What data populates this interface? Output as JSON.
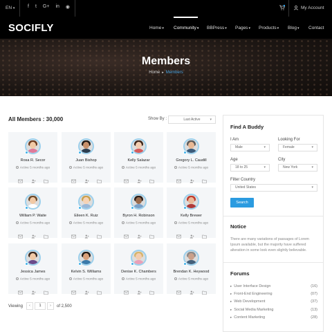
{
  "topbar": {
    "language": "EN",
    "social_icons": [
      "facebook-icon",
      "twitter-icon",
      "google-plus-icon",
      "linkedin-icon",
      "rss-icon"
    ],
    "account_label": "My Account"
  },
  "brand": {
    "logo_part1": "SOCI",
    "logo_part2": "FLY"
  },
  "nav": {
    "items": [
      {
        "label": "Home",
        "caret": "▾"
      },
      {
        "label": "Community",
        "caret": "▾"
      },
      {
        "label": "BBPress",
        "caret": "▾"
      },
      {
        "label": "Pages",
        "caret": "▾"
      },
      {
        "label": "Products",
        "caret": "▾"
      },
      {
        "label": "Blog",
        "caret": "▾"
      },
      {
        "label": "Contact",
        "caret": ""
      }
    ]
  },
  "hero": {
    "title": "Members",
    "breadcrumb_home": "Home",
    "breadcrumb_current": "Members"
  },
  "members_header": {
    "title": "All Members : 30,000",
    "show_by_label": "Show By :",
    "show_by_value": "Last Active"
  },
  "members": [
    {
      "name": "Rosa R. Secor",
      "active": "Active 5 months ago"
    },
    {
      "name": "Juan Bishop",
      "active": "Active 5 months ago"
    },
    {
      "name": "Kelly Salazar",
      "active": "Active 5 months ago"
    },
    {
      "name": "Gregory L. Caudill",
      "active": "Active 5 months ago"
    },
    {
      "name": "William P. Waite",
      "active": "Active 5 months ago"
    },
    {
      "name": "Eileen K. Ruiz",
      "active": "Active 5 months ago"
    },
    {
      "name": "Byron H. Robinson",
      "active": "Active 5 months ago"
    },
    {
      "name": "Kelly Brewer",
      "active": "Active 5 months ago"
    },
    {
      "name": "Jessica James",
      "active": "Active 5 months ago"
    },
    {
      "name": "Kelvin S. Williams",
      "active": "Active 5 months ago"
    },
    {
      "name": "Denise K. Chambers",
      "active": "Active 5 months ago"
    },
    {
      "name": "Brendan K. Heywood",
      "active": "Active 5 months ago"
    }
  ],
  "pagination": {
    "viewing_label": "Viewing",
    "prev": "‹",
    "page": "1",
    "next": "›",
    "of_total": "of 2,500"
  },
  "find_buddy": {
    "title": "Find A Buddy",
    "i_am_label": "I Am",
    "i_am_value": "Male",
    "looking_for_label": "Looking For",
    "looking_for_value": "Female",
    "age_label": "Age",
    "age_value": "18 to 25",
    "city_label": "City",
    "city_value": "New York",
    "country_label": "Filter Country",
    "country_value": "United States",
    "search_label": "Search"
  },
  "notice": {
    "title": "Notice",
    "text": "There are many variations of passages of Lorem Ipsum available, but the majority have suffered alteration in some look even slightly believable."
  },
  "forums": {
    "title": "Forums",
    "items": [
      {
        "label": "User Interface Design",
        "count": "(16)"
      },
      {
        "label": "Front-End Engineering",
        "count": "(07)"
      },
      {
        "label": "Web Development",
        "count": "(37)"
      },
      {
        "label": "Social Media Marketing",
        "count": "(13)"
      },
      {
        "label": "Content Marketing",
        "count": "(28)"
      }
    ]
  },
  "colors": {
    "accent": "#2b9be0",
    "online_dot": "#3fb0e8",
    "card_bg": "#f4f6f8",
    "header_bg": "#000000"
  }
}
